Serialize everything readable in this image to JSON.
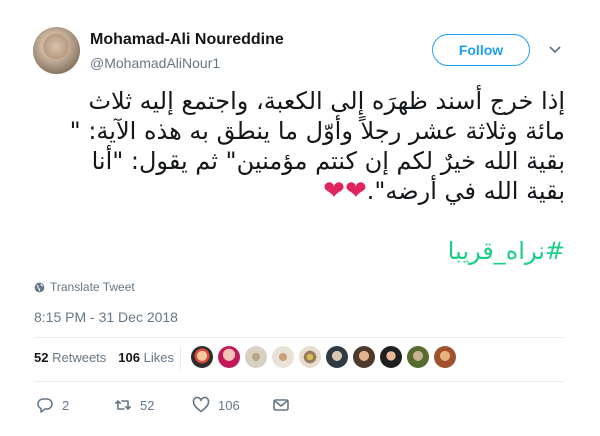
{
  "tweet": {
    "author": {
      "display_name": "Mohamad-Ali Noureddine",
      "handle": "@MohamadAliNour1"
    },
    "follow_label": "Follow",
    "text_line1": "إذا خرج أسند ظهرَه إلى الكعبة، واجتمع إليه ثلاث",
    "text_line2": "مائة وثلاثة عشر رجلاً وأوّل ما ينطق به هذه الآية: \"",
    "text_line3": "بقية الله خيرٌ لكم إن كنتم مؤمنين\" ثم يقول: \"أنا",
    "text_line4": "بقية الله في أرضه\".",
    "hearts": "❤❤",
    "hashtag": "#نراه_قريبا",
    "translate_label": "Translate Tweet",
    "timestamp": "8:15 PM - 31 Dec 2018",
    "retweets_count": "52",
    "retweets_label": "Retweets",
    "likes_count": "106",
    "likes_label": "Likes",
    "reply_count": "2",
    "retweet_count_action": "52",
    "like_count_action": "106"
  },
  "colors": {
    "accent": "#1da1f2",
    "hashtag": "#19cf86",
    "heart": "#e0245e",
    "muted": "#657786"
  },
  "icons": [
    "globe-icon",
    "chevron-down-icon",
    "reply-icon",
    "retweet-icon",
    "like-icon",
    "dm-icon"
  ]
}
